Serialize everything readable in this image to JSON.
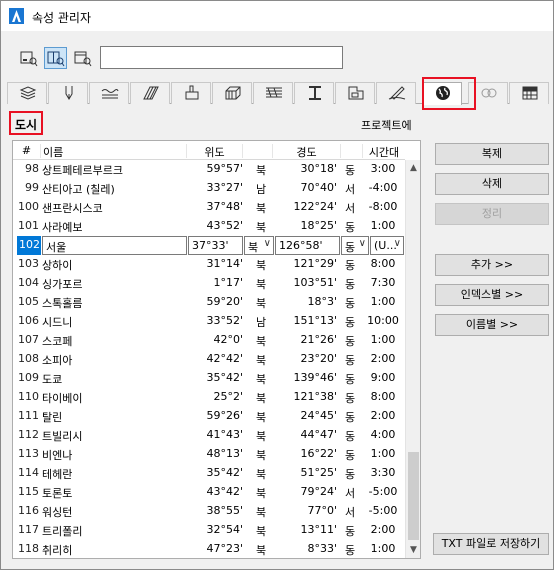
{
  "window": {
    "title": "속성 관리자"
  },
  "search": {
    "value": ""
  },
  "section": {
    "title": "도시",
    "hint": "프로젝트에"
  },
  "table": {
    "headers": {
      "num": "#",
      "name": "이름",
      "lat": "위도",
      "lon": "경도",
      "tz": "시간대"
    },
    "rows": [
      {
        "num": "98",
        "name": "상트페테르부르크",
        "lat": "59°57'",
        "ns": "북",
        "lon": "30°18'",
        "ew": "동",
        "tz": "3:00"
      },
      {
        "num": "99",
        "name": "산티아고 (칠레)",
        "lat": "33°27'",
        "ns": "남",
        "lon": "70°40'",
        "ew": "서",
        "tz": "-4:00"
      },
      {
        "num": "100",
        "name": "샌프란시스코",
        "lat": "37°48'",
        "ns": "북",
        "lon": "122°24'",
        "ew": "서",
        "tz": "-8:00"
      },
      {
        "num": "101",
        "name": "사라예보",
        "lat": "43°52'",
        "ns": "북",
        "lon": "18°25'",
        "ew": "동",
        "tz": "1:00"
      },
      {
        "num": "102",
        "name": "서울",
        "lat": "37°33'",
        "ns": "북",
        "lon": "126°58'",
        "ew": "동",
        "tz": "(U..."
      },
      {
        "num": "103",
        "name": "상하이",
        "lat": "31°14'",
        "ns": "북",
        "lon": "121°29'",
        "ew": "동",
        "tz": "8:00"
      },
      {
        "num": "104",
        "name": "싱가포르",
        "lat": "1°17'",
        "ns": "북",
        "lon": "103°51'",
        "ew": "동",
        "tz": "7:30"
      },
      {
        "num": "105",
        "name": "스톡홀름",
        "lat": "59°20'",
        "ns": "북",
        "lon": "18°3'",
        "ew": "동",
        "tz": "1:00"
      },
      {
        "num": "106",
        "name": "시드니",
        "lat": "33°52'",
        "ns": "남",
        "lon": "151°13'",
        "ew": "동",
        "tz": "10:00"
      },
      {
        "num": "107",
        "name": "스코페",
        "lat": "42°0'",
        "ns": "북",
        "lon": "21°26'",
        "ew": "동",
        "tz": "1:00"
      },
      {
        "num": "108",
        "name": "소피아",
        "lat": "42°42'",
        "ns": "북",
        "lon": "23°20'",
        "ew": "동",
        "tz": "2:00"
      },
      {
        "num": "109",
        "name": "도쿄",
        "lat": "35°42'",
        "ns": "북",
        "lon": "139°46'",
        "ew": "동",
        "tz": "9:00"
      },
      {
        "num": "110",
        "name": "타이베이",
        "lat": "25°2'",
        "ns": "북",
        "lon": "121°38'",
        "ew": "동",
        "tz": "8:00"
      },
      {
        "num": "111",
        "name": "탈린",
        "lat": "59°26'",
        "ns": "북",
        "lon": "24°45'",
        "ew": "동",
        "tz": "2:00"
      },
      {
        "num": "112",
        "name": "트빌리시",
        "lat": "41°43'",
        "ns": "북",
        "lon": "44°47'",
        "ew": "동",
        "tz": "4:00"
      },
      {
        "num": "113",
        "name": "비엔나",
        "lat": "48°13'",
        "ns": "북",
        "lon": "16°22'",
        "ew": "동",
        "tz": "1:00"
      },
      {
        "num": "114",
        "name": "테헤란",
        "lat": "35°42'",
        "ns": "북",
        "lon": "51°25'",
        "ew": "동",
        "tz": "3:30"
      },
      {
        "num": "115",
        "name": "토론토",
        "lat": "43°42'",
        "ns": "북",
        "lon": "79°24'",
        "ew": "서",
        "tz": "-5:00"
      },
      {
        "num": "116",
        "name": "워싱턴",
        "lat": "38°55'",
        "ns": "북",
        "lon": "77°0'",
        "ew": "서",
        "tz": "-5:00"
      },
      {
        "num": "117",
        "name": "트리폴리",
        "lat": "32°54'",
        "ns": "북",
        "lon": "13°11'",
        "ew": "동",
        "tz": "2:00"
      },
      {
        "num": "118",
        "name": "취리히",
        "lat": "47°23'",
        "ns": "북",
        "lon": "8°33'",
        "ew": "동",
        "tz": "1:00"
      }
    ]
  },
  "buttons": {
    "duplicate": "복제",
    "delete": "삭제",
    "purge": "정리",
    "add": "추가 >>",
    "by_index": "인덱스별 >>",
    "by_name": "이름별 >>",
    "save_txt": "TXT 파일로 저장하기"
  },
  "icons": {
    "tabs": [
      "layers-icon",
      "pen-icon",
      "line-type-icon",
      "fill-pattern-icon",
      "building-material-icon",
      "composite-icon",
      "profile-icon",
      "zone-icon",
      "markup-icon",
      "renovation-icon",
      "location-globe-icon",
      "mep-icon",
      "table-grid-icon"
    ]
  },
  "colors": {
    "highlight_red": "#e81123",
    "selection_blue": "#0078d7"
  }
}
